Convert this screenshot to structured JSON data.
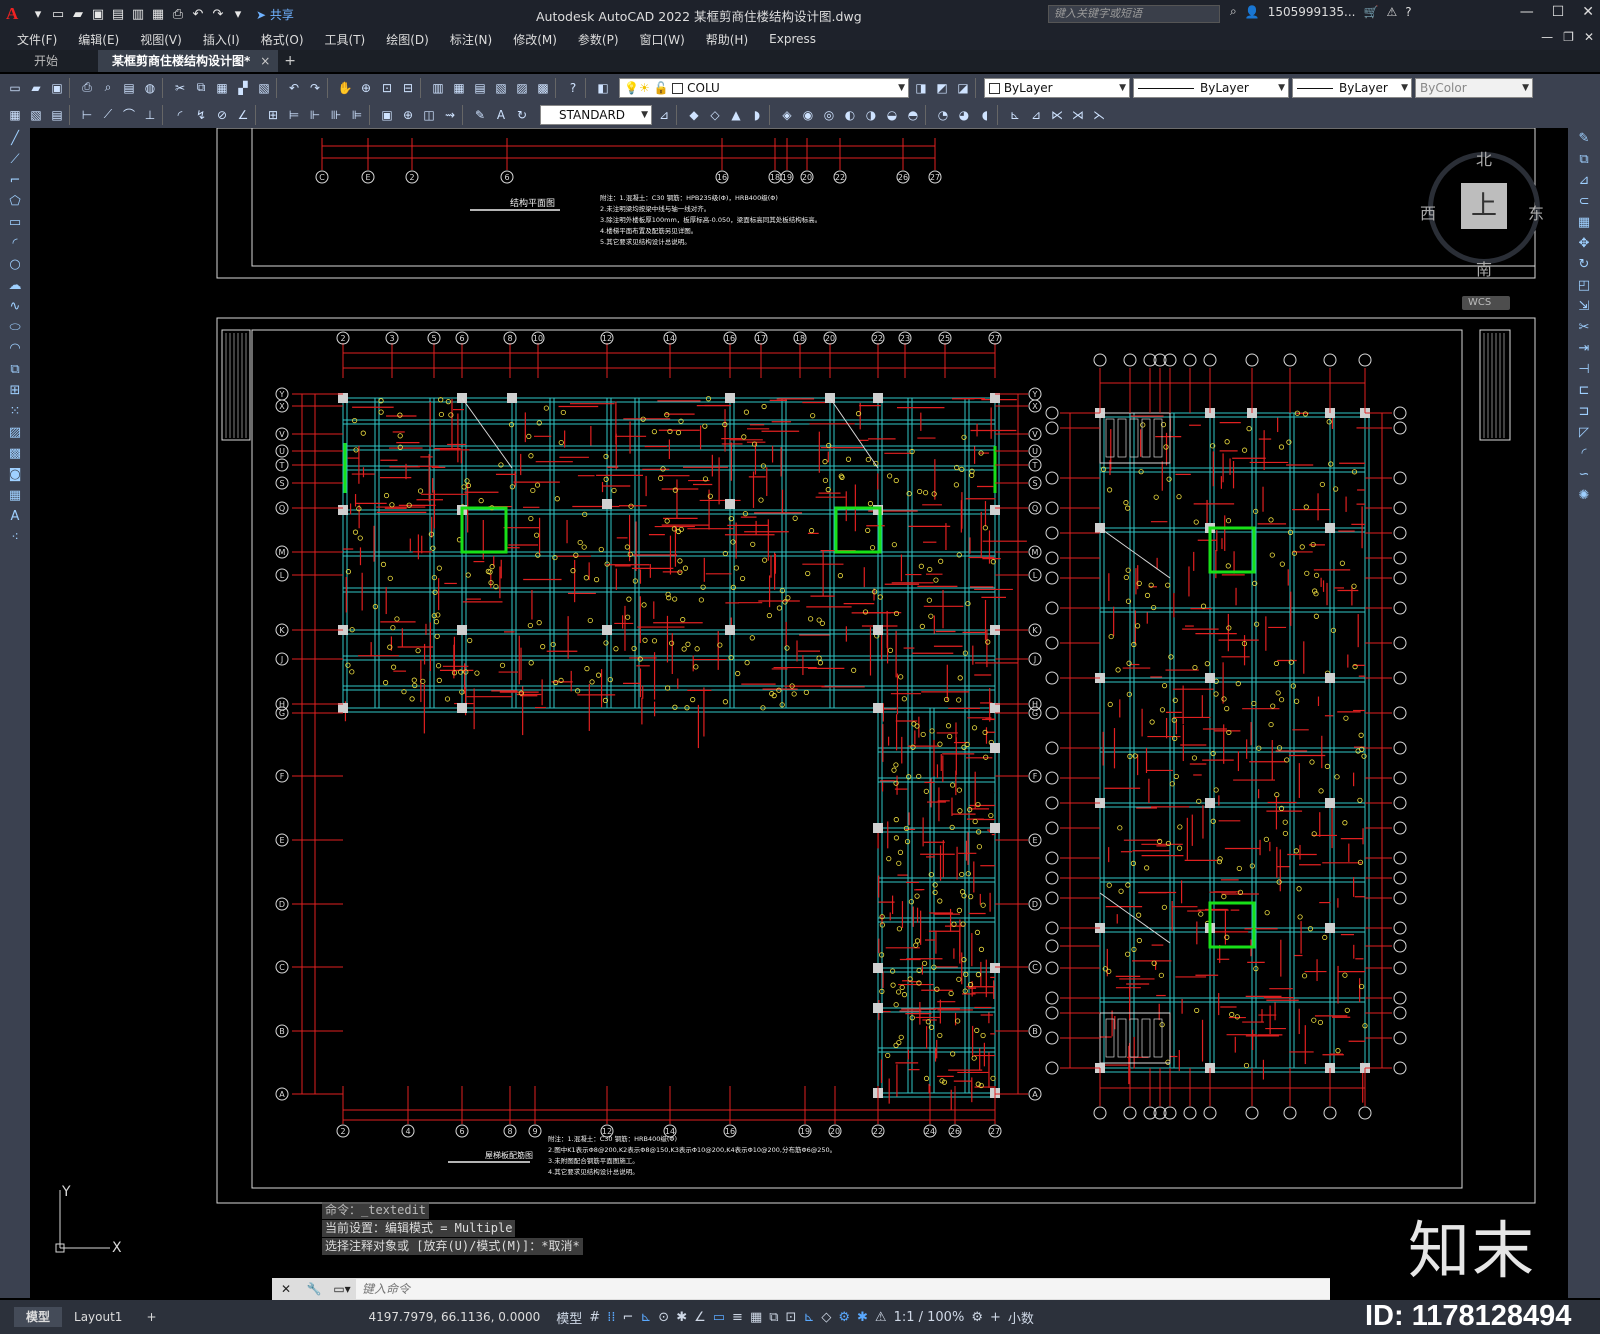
{
  "app": {
    "window_title": "Autodesk AutoCAD 2022    某框剪商住楼结构设计图.dwg",
    "share_label": "共享",
    "search_placeholder": "键入关键字或短语",
    "user": "1505999135...",
    "logo": "A"
  },
  "menu": [
    "文件(F)",
    "编辑(E)",
    "视图(V)",
    "插入(I)",
    "格式(O)",
    "工具(T)",
    "绘图(D)",
    "标注(N)",
    "修改(M)",
    "参数(P)",
    "窗口(W)",
    "帮助(H)",
    "Express"
  ],
  "tabs": {
    "start": "开始",
    "document": "某框剪商住楼结构设计图*",
    "close": "×",
    "add": "+"
  },
  "toolbar": {
    "layer": "COLU",
    "text_style": "STANDARD",
    "color": "ByLayer",
    "linetype": "ByLayer",
    "lineweight": "ByLayer",
    "plotstyle": "ByColor"
  },
  "viewcube": {
    "north": "北",
    "south": "南",
    "east": "东",
    "west": "西",
    "top": "上",
    "wcs": "WCS"
  },
  "drawing": {
    "plan_title_top": "结构平面图",
    "plan_title_left": "屋梯板配筋图",
    "notes_top": [
      "附注：1.混凝土：C30  钢筋：HPB235级(Φ)，HRB400级(Φ)",
      "2.未注明梁均按梁中线与轴一线对齐。",
      "3.除注明外楼板厚100mm，板厚标高-0.050，梁面标高同其处板结构标高。",
      "4.楼梯平面布置及配筋另见详图。",
      "5.其它要求见结构设计总说明。"
    ],
    "notes_bottom": [
      "附注：1.混凝土：C30  钢筋：HRB400级(Φ)",
      "2.图中K1表示Φ8@200,K2表示Φ8@150,K3表示Φ10@200,K4表示Φ10@200,分布筋Φ6@250。",
      "3.未附图配合钢筋平面图施工。",
      "4.其它要求见结构设计总说明。"
    ],
    "axis_top": [
      "2",
      "3",
      "5",
      "6",
      "8",
      "10",
      "12",
      "14",
      "16",
      "17",
      "18",
      "20",
      "22",
      "23",
      "25",
      "27"
    ],
    "axis_bottom": [
      "2",
      "4",
      "6",
      "8",
      "9",
      "12",
      "14",
      "16",
      "19",
      "20",
      "22",
      "24",
      "26",
      "27"
    ],
    "axis_left": [
      "Y",
      "X",
      "V",
      "U",
      "T",
      "S",
      "Q",
      "M",
      "L",
      "K",
      "J",
      "H",
      "G",
      "F",
      "E",
      "D",
      "C",
      "B",
      "A"
    ],
    "axis_top_upper": [
      "C",
      "E",
      "2",
      "6",
      "16",
      "18",
      "19",
      "20",
      "22",
      "26",
      "27"
    ]
  },
  "command": {
    "line1": "命令：_textedit",
    "line2": "当前设置：编辑模式 = Multiple",
    "line3": "选择注释对象或 [放弃(U)/模式(M)]：*取消*",
    "input_placeholder": "键入命令"
  },
  "status": {
    "model_tab": "模型",
    "layout_tab": "Layout1",
    "add": "+",
    "coords": "4197.7979, 66.1136, 0.0000",
    "model_btn": "模型",
    "scale": "1:1 / 100%",
    "units": "小数"
  },
  "watermark": {
    "brand": "知末",
    "id": "ID: 1178128494"
  },
  "colors": {
    "beam": "#31c6c6",
    "rebar": "#e02020",
    "text": "#f0e040",
    "highlight": "#18e018",
    "column": "#d0d0d0",
    "frame": "#d8d8d8",
    "bg": "#000000"
  }
}
